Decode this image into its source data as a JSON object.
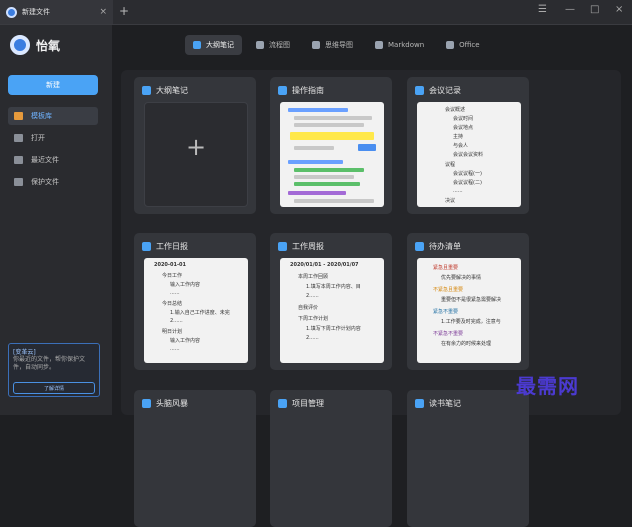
{
  "window": {
    "tab_title": "新建文件",
    "tab_close": "×",
    "new_tab": "+",
    "controls": [
      "☰",
      "—",
      "□",
      "×"
    ]
  },
  "sidebar": {
    "brand": "怡氧",
    "new_button": "新建",
    "items": [
      {
        "label": "模板库",
        "icon": "template-icon",
        "active": true
      },
      {
        "label": "打开",
        "icon": "folder-icon",
        "active": false
      },
      {
        "label": "最近文件",
        "icon": "recent-icon",
        "active": false
      },
      {
        "label": "保护文件",
        "icon": "shield-icon",
        "active": false
      }
    ],
    "promo": {
      "title": "[变革云]",
      "text": "你最近的文件，帮你保护文件，自动同步。",
      "button": "了解详情"
    }
  },
  "type_tabs": [
    {
      "label": "大纲笔记",
      "active": true
    },
    {
      "label": "流程图",
      "active": false
    },
    {
      "label": "思维导图",
      "active": false
    },
    {
      "label": "Markdown",
      "active": false
    },
    {
      "label": "Office",
      "active": false
    }
  ],
  "cards": [
    {
      "title": "大纲笔记",
      "blank": true
    },
    {
      "title": "操作指南"
    },
    {
      "title": "会议记录"
    },
    {
      "title": "工作日报"
    },
    {
      "title": "工作周报"
    },
    {
      "title": "待办清单"
    },
    {
      "title": "头脑风暴"
    },
    {
      "title": "项目管理"
    },
    {
      "title": "读书笔记"
    }
  ],
  "thumbs": {
    "daily": [
      "2020-01-01",
      "今日工作",
      "输入工作内容",
      "......",
      "今日总结",
      "1.输入自己工作进度、未完",
      "2......",
      "明日计划",
      "输入工作内容",
      "......"
    ],
    "weekly": [
      "2020/01/01 - 2020/01/07",
      "本周工作回顾",
      "1.填写本周工作内容、目",
      "2......",
      "自我评价",
      "下周工作计划",
      "1.填写下周工作计划内容",
      "2......"
    ],
    "meeting": [
      "会议概述",
      "会议时间",
      "会议地点",
      "主持",
      "与会人",
      "会议会议资料",
      "议程",
      "会议议程(一)",
      "会议议程(二)",
      "......",
      "决议"
    ],
    "todo": [
      "紧急且重要",
      "优先要解决的事情",
      "不紧急且重要",
      "重要但不是很紧急需要解决",
      "紧急不重要",
      "1.工作要及时完成，注意与",
      "不紧急不重要",
      "在有余力的时候来处理"
    ]
  },
  "watermark": "最需网"
}
